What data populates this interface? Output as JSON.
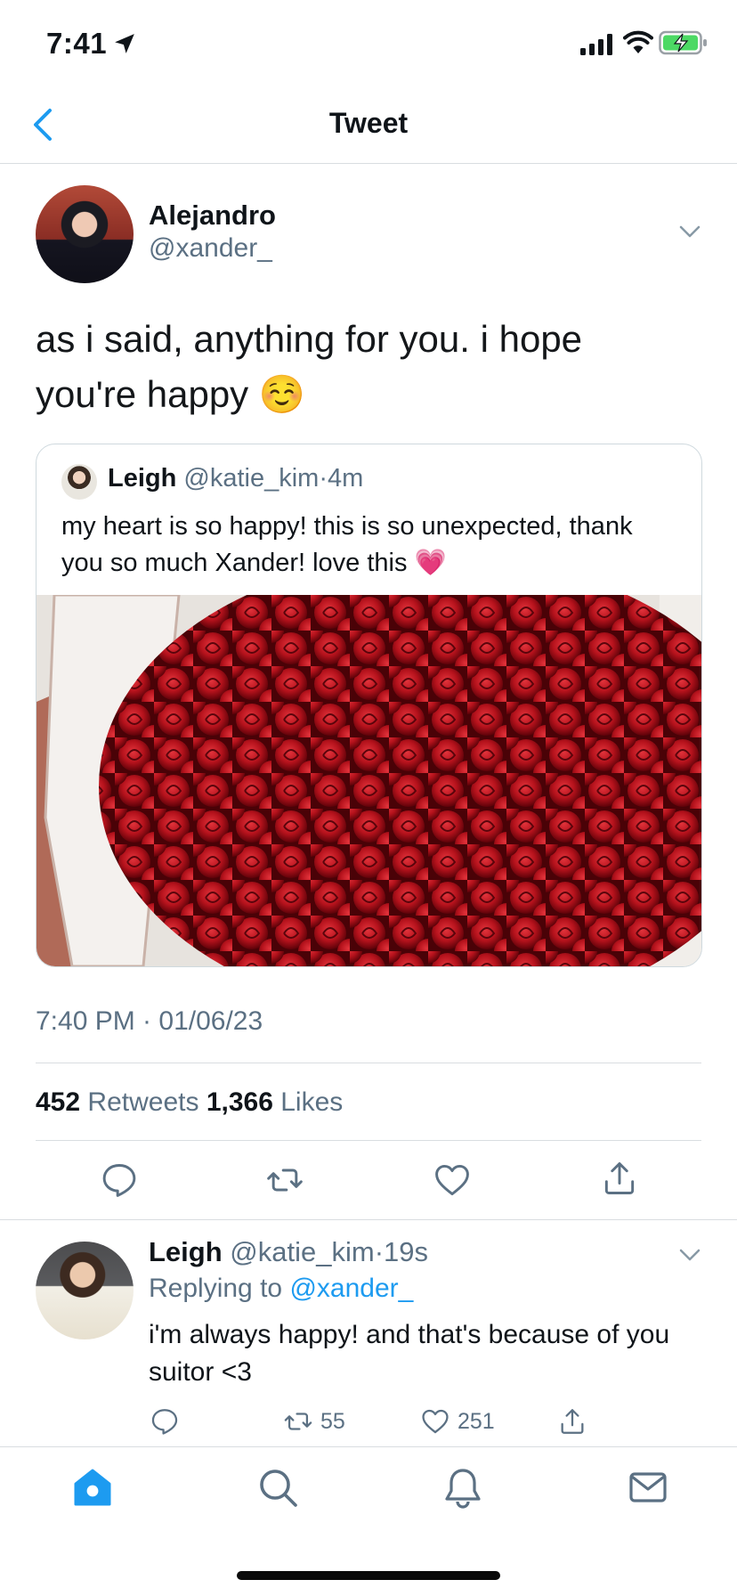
{
  "status_bar": {
    "time": "7:41"
  },
  "header": {
    "title": "Tweet"
  },
  "tweet": {
    "author_name": "Alejandro",
    "author_handle": "@xander_",
    "text": "as i said, anything for you. i hope you're happy ☺️",
    "quote": {
      "name": "Leigh",
      "handle": "@katie_kim",
      "separator": "·",
      "time": "4m",
      "text": "my heart is so happy! this is so unexpected, thank you so much Xander! love this 💗"
    },
    "timestamp": "7:40 PM · 01/06/23",
    "retweets_count": "452",
    "retweets_label": "Retweets",
    "likes_count": "1,366",
    "likes_label": "Likes"
  },
  "reply": {
    "name": "Leigh",
    "handle": "@katie_kim",
    "separator": "·",
    "time": "19s",
    "replying_prefix": "Replying to",
    "replying_handle": "@xander_",
    "text": "i'm always happy! and that's because of you suitor <3",
    "retweets_count": "55",
    "likes_count": "251"
  },
  "icons": {
    "status": [
      "location-arrow-icon",
      "cellular-signal-icon",
      "wifi-icon",
      "battery-charging-icon"
    ],
    "tabs": [
      "home-icon",
      "search-icon",
      "notifications-icon",
      "messages-icon"
    ]
  },
  "colors": {
    "accent": "#1d9bf0",
    "secondary_text": "#5b7083",
    "battery_fill": "#4cd964"
  }
}
